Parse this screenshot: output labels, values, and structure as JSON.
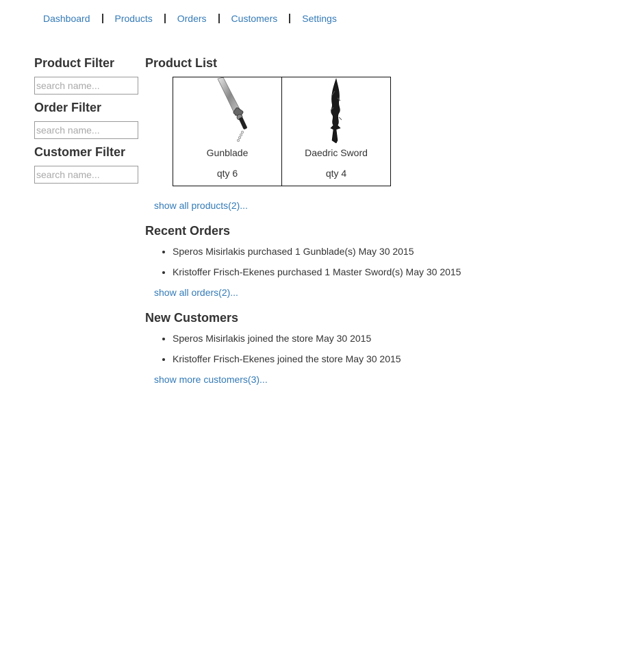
{
  "nav": {
    "items": [
      {
        "label": "Dashboard"
      },
      {
        "label": "Products"
      },
      {
        "label": "Orders"
      },
      {
        "label": "Customers"
      },
      {
        "label": "Settings"
      }
    ]
  },
  "sidebar": {
    "product_filter": {
      "title": "Product Filter",
      "placeholder": "search name...",
      "value": ""
    },
    "order_filter": {
      "title": "Order Filter",
      "placeholder": "search name...",
      "value": ""
    },
    "customer_filter": {
      "title": "Customer Filter",
      "placeholder": "search name...",
      "value": ""
    }
  },
  "products": {
    "title": "Product List",
    "items": [
      {
        "name": "Gunblade",
        "qty": "qty 6",
        "icon": "gunblade-image"
      },
      {
        "name": "Daedric Sword",
        "qty": "qty 4",
        "icon": "daedric-sword-image"
      }
    ],
    "show_all": "show all products(2)..."
  },
  "orders": {
    "title": "Recent Orders",
    "items": [
      "Speros Misirlakis purchased 1 Gunblade(s) May 30 2015",
      "Kristoffer Frisch-Ekenes purchased 1 Master Sword(s) May 30 2015"
    ],
    "show_all": "show all orders(2)..."
  },
  "customers": {
    "title": "New Customers",
    "items": [
      "Speros Misirlakis joined the store May 30 2015",
      "Kristoffer Frisch-Ekenes joined the store May 30 2015"
    ],
    "show_more": "show more customers(3)..."
  },
  "colors": {
    "link": "#337ab7",
    "text": "#333333"
  }
}
